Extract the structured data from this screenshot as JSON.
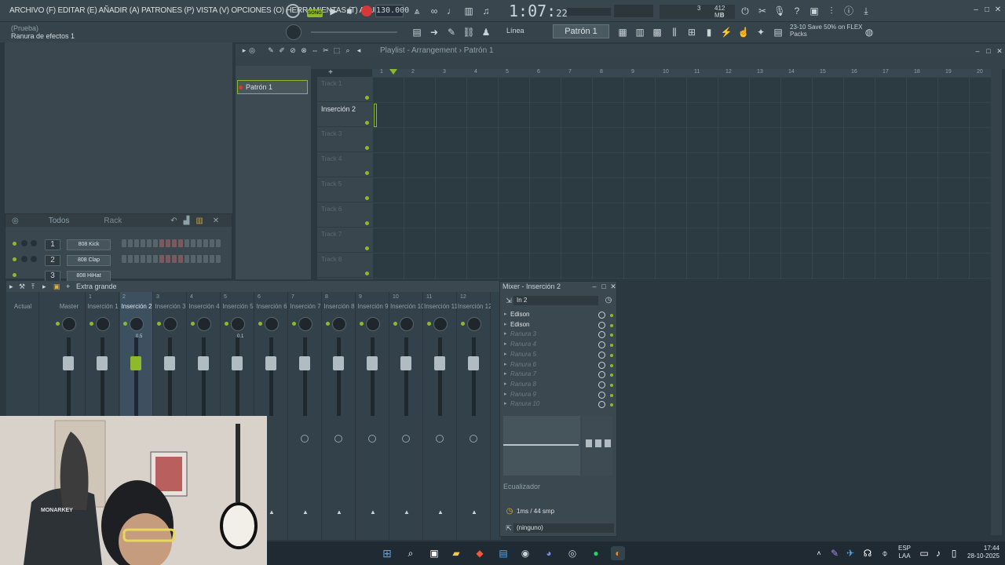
{
  "menu": {
    "text": "ARCHIVO (F) EDITAR (E) AÑADIR (A) PATRONES (P) VISTA (V) OPCIONES (O) HERRAMIENTAS (T) AYUDA"
  },
  "transport": {
    "song_label": "SONG",
    "tempo": "130.000",
    "time_main": "1:07",
    "time_sub": "22"
  },
  "stats": {
    "cpu": "3",
    "ram": "412 MB",
    "poly": "0"
  },
  "hint": {
    "line1": "(Prueba)",
    "line2": "Ranura de efectos 1"
  },
  "toolbar": {
    "snap": "Línea",
    "pattern": "Patrón 1"
  },
  "news": {
    "line1": "23-10  Save 50% on FLEX",
    "line2": "Packs"
  },
  "rack": {
    "filter": "Todos",
    "title": "Rack",
    "channels": [
      {
        "num": "1",
        "name": "808 Kick"
      },
      {
        "num": "2",
        "name": "808 Clap"
      },
      {
        "num": "3",
        "name": "808 HiHat"
      }
    ]
  },
  "playlist": {
    "title": "Playlist - Arrangement",
    "crumb": "Patrón 1",
    "pattern_item": "Patrón 1",
    "tracks": [
      "Track 1",
      "Inserción 2",
      "Track 3",
      "Track 4",
      "Track 5",
      "Track 6",
      "Track 7",
      "Track 8"
    ],
    "ruler": [
      "1",
      "2",
      "3",
      "4",
      "5",
      "6",
      "7",
      "8",
      "9",
      "10",
      "11",
      "12",
      "13",
      "14",
      "15",
      "16",
      "17",
      "18",
      "19",
      "20"
    ]
  },
  "mixer": {
    "view": "Extra grande",
    "strips": [
      {
        "num": "",
        "name": "Actual"
      },
      {
        "num": "",
        "name": "Master"
      },
      {
        "num": "1",
        "name": "Inserción 1"
      },
      {
        "num": "2",
        "name": "Inserción 2"
      },
      {
        "num": "3",
        "name": "Inserción 3"
      },
      {
        "num": "4",
        "name": "Inserción 4"
      },
      {
        "num": "5",
        "name": "Inserción 5"
      },
      {
        "num": "6",
        "name": "Inserción 6"
      },
      {
        "num": "7",
        "name": "Inserción 7"
      },
      {
        "num": "8",
        "name": "Inserción 8"
      },
      {
        "num": "9",
        "name": "Inserción 9"
      },
      {
        "num": "10",
        "name": "Inserción 10"
      },
      {
        "num": "11",
        "name": "Inserción 11"
      },
      {
        "num": "12",
        "name": "Inserción 12"
      }
    ],
    "strip_master_sub": "Master",
    "vol_sel": "0.5",
    "vol_5": "0.1"
  },
  "insert": {
    "title": "Mixer - Inserción 2",
    "input": "In 2",
    "slots": [
      {
        "name": "Edison",
        "on": true
      },
      {
        "name": "Edison",
        "on": true
      },
      {
        "name": "Ranura 3",
        "on": false
      },
      {
        "name": "Ranura 4",
        "on": false
      },
      {
        "name": "Ranura 5",
        "on": false
      },
      {
        "name": "Ranura 6",
        "on": false
      },
      {
        "name": "Ranura 7",
        "on": false
      },
      {
        "name": "Ranura 8",
        "on": false
      },
      {
        "name": "Ranura 9",
        "on": false
      },
      {
        "name": "Ranura 10",
        "on": false
      }
    ],
    "eq_label": "Ecualizador",
    "latency": "1ms / 44 smp",
    "output": "(ninguno)"
  },
  "taskbar": {
    "lang1": "ESP",
    "lang2": "LAA",
    "time": "17:44",
    "date": "28-10-2025"
  },
  "colors": {
    "accent": "#8fb92d",
    "record": "#d9383a"
  }
}
